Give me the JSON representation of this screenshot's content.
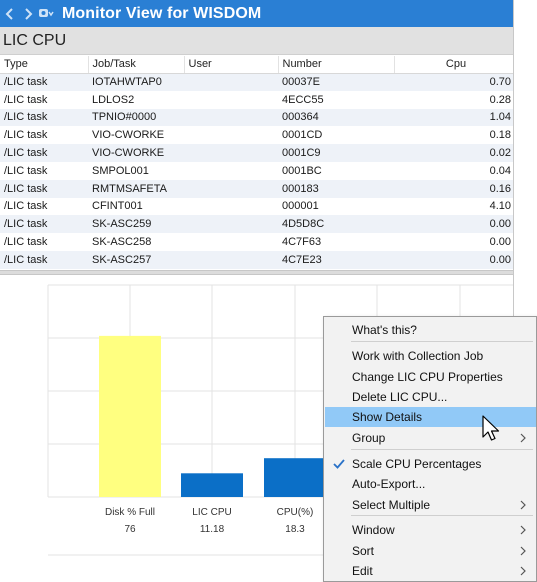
{
  "window": {
    "title": "Monitor View for WISDOM"
  },
  "panel": {
    "title": "LIC CPU"
  },
  "table": {
    "columns": [
      "Type",
      "Job/Task",
      "User",
      "Number",
      "Cpu"
    ],
    "rows": [
      [
        "/LIC task",
        "IOTAHWTAP0",
        "",
        "00037E",
        "0.70"
      ],
      [
        "/LIC task",
        "LDLOS2",
        "",
        "4ECC55",
        "0.28"
      ],
      [
        "/LIC task",
        "TPNIO#0000",
        "",
        "000364",
        "1.04"
      ],
      [
        "/LIC task",
        "VIO-CWORKE",
        "",
        "0001CD",
        "0.18"
      ],
      [
        "/LIC task",
        "VIO-CWORKE",
        "",
        "0001C9",
        "0.02"
      ],
      [
        "/LIC task",
        "SMPOL001",
        "",
        "0001BC",
        "0.04"
      ],
      [
        "/LIC task",
        "RMTMSAFETA",
        "",
        "000183",
        "0.16"
      ],
      [
        "/LIC task",
        "CFINT001",
        "",
        "000001",
        "4.10"
      ],
      [
        "/LIC task",
        "SK-ASC259",
        "",
        "4D5D8C",
        "0.00"
      ],
      [
        "/LIC task",
        "SK-ASC258",
        "",
        "4C7F63",
        "0.00"
      ],
      [
        "/LIC task",
        "SK-ASC257",
        "",
        "4C7E23",
        "0.00"
      ]
    ]
  },
  "chart_data": {
    "type": "bar",
    "categories": [
      "Disk % Full",
      "LIC CPU",
      "CPU(%)"
    ],
    "values": [
      76,
      11.18,
      18.3
    ],
    "value_labels": [
      "76",
      "11.18",
      "18.3"
    ],
    "colors": [
      "#ffff80",
      "#0b6fc7",
      "#0b6fc7"
    ],
    "grid": true,
    "ylim": [
      0,
      100
    ],
    "xlabel": "",
    "ylabel": ""
  },
  "context_menu": {
    "items": [
      {
        "label": "What's this?",
        "submenu": false,
        "checked": false,
        "highlighted": false
      },
      {
        "label": "Work with Collection Job",
        "submenu": false,
        "checked": false,
        "highlighted": false
      },
      {
        "label": "Change LIC CPU Properties",
        "submenu": false,
        "checked": false,
        "highlighted": false
      },
      {
        "label": "Delete LIC CPU...",
        "submenu": false,
        "checked": false,
        "highlighted": false
      },
      {
        "label": "Show Details",
        "submenu": false,
        "checked": false,
        "highlighted": true
      },
      {
        "label": "Group",
        "submenu": true,
        "checked": false,
        "highlighted": false
      },
      {
        "label": "Scale CPU Percentages",
        "submenu": false,
        "checked": true,
        "highlighted": false
      },
      {
        "label": "Auto-Export...",
        "submenu": false,
        "checked": false,
        "highlighted": false
      },
      {
        "label": "Select Multiple",
        "submenu": true,
        "checked": false,
        "highlighted": false
      },
      {
        "label": "Window",
        "submenu": true,
        "checked": false,
        "highlighted": false
      },
      {
        "label": "Sort",
        "submenu": true,
        "checked": false,
        "highlighted": false
      },
      {
        "label": "Edit",
        "submenu": true,
        "checked": false,
        "highlighted": false
      }
    ]
  },
  "colors": {
    "titlebar": "#2a7fd4",
    "highlight": "#91c9f7",
    "bar_primary": "#0b6fc7",
    "bar_yellow": "#ffff80"
  }
}
